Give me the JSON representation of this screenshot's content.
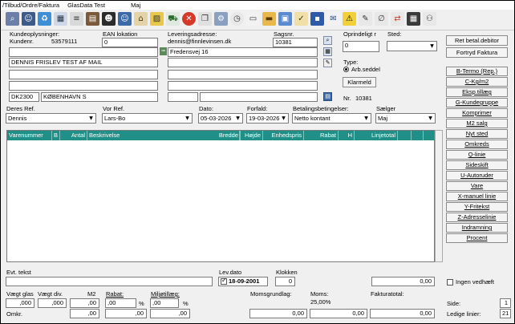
{
  "titlebar": {
    "path": "/Tilbud/Ordre/Faktura",
    "app": "GlasData Test",
    "user": "Maj"
  },
  "toolbar_icons": [
    "binoculars-icon",
    "customer-icon",
    "recycle-icon",
    "calendar-icon",
    "list-icon",
    "notebook-icon",
    "person-icon",
    "user-icon",
    "house-icon",
    "picture-icon",
    "cart-icon",
    "stop-icon",
    "copy-icon",
    "settings-icon",
    "clock-icon",
    "document-icon",
    "folder-icon",
    "window-icon",
    "checklist-icon",
    "save-icon",
    "mail-icon",
    "warning-icon",
    "pen-icon",
    "attach-icon",
    "refresh-icon",
    "calculator-icon",
    "network-icon"
  ],
  "customer": {
    "heading": "Kundeoplysninger:",
    "kundenr_label": "Kundenr.",
    "kundenr": "53579111",
    "ean_label": "EAN lokation",
    "ean": "0",
    "line1": "",
    "name": "DENNIS FRISLEV TEST AF MAIL",
    "line3": "",
    "line4": "",
    "zip": "DK2300",
    "city": "KØBENHAVN S"
  },
  "delivery": {
    "heading": "Leveringsadresse:",
    "email": "dennis@finnlevinsen.dk",
    "sagsnr_label": "Sagsnr.",
    "sagsnr": "10381",
    "street": "Fredensvej 16"
  },
  "right_panel": {
    "oprindeligt_label": "Oprindeligt r",
    "oprindeligt": "0",
    "sted_label": "Sted:",
    "type_label": "Type:",
    "type_value": "Arb.seddel",
    "klarmeld": "Klarmeld",
    "nr_label": "Nr.",
    "nr": "10381"
  },
  "order": {
    "deres_ref_label": "Deres Ref.",
    "deres_ref": "Dennis",
    "vor_ref_label": "Vor Ref.",
    "vor_ref": "Lars-Bo",
    "dato_label": "Dato:",
    "dato": "05-03-2026",
    "forfald_label": "Forfald:",
    "forfald": "19-03-2026",
    "betaling_label": "Betalingsbetingelser:",
    "betaling": "Netto kontant",
    "saelger_label": "Sælger",
    "saelger": "Maj"
  },
  "grid_columns": [
    "Varenummer",
    "B",
    "Antal",
    "Beskrivelse",
    "Bredde",
    "Højde",
    "Enhedspris",
    "Rabat",
    "H",
    "Linjetotal"
  ],
  "top_buttons": [
    "Ret betal.debitor",
    "Fortryd Faktura"
  ],
  "side_buttons": [
    "B-Termo (Rep.)",
    "C-Kg/m2",
    "Eksp.tillæg",
    "G-Kundegruppe",
    "Komprimer",
    "M2 salg",
    "Nyt sted",
    "Omkreds",
    "Q-linie",
    "Sideskift",
    "U-Autoruder",
    "Vare",
    "X-manuel linie",
    "Y-Fritekst",
    "Z-Adresselinie",
    "Indramning",
    "Procent"
  ],
  "footer": {
    "evt_tekst_label": "Evt. tekst",
    "evt_tekst": "",
    "levdato_label": "Lev.dato",
    "levdato": "18-09-2001",
    "klokken_label": "Klokken",
    "klokken": "0",
    "total_top": "0,00",
    "ingen_vedhaeft": "Ingen vedhæft",
    "vaegt_glas_label": "Vægt glas",
    "vaegt_glas": ",000",
    "vaegt_div_label": "Vægt div.",
    "vaegt_div": ",000",
    "m2_label": "M2",
    "m2": ",00",
    "rabat_label": "Rabat:",
    "rabat": ",00",
    "rabat_pct": "%",
    "miljo_label": "Miljøtillæg:",
    "miljo": ",00",
    "miljo_pct": "%",
    "momsgrundlag_label": "Momsgrundlag:",
    "moms_label": "Moms:",
    "moms_pct": "25,00%",
    "fakturatotal_label": "Fakturatotal:",
    "omkr_label": "Omkr.",
    "omkr": ",00",
    "rabat2": ",00",
    "miljo2": ",00",
    "momsgrundlag": "0,00",
    "moms": "0,00",
    "fakturatotal": "0,00",
    "side_label": "Side:",
    "side": "1",
    "ledige_label": "Ledige linier:",
    "ledige": "21"
  }
}
